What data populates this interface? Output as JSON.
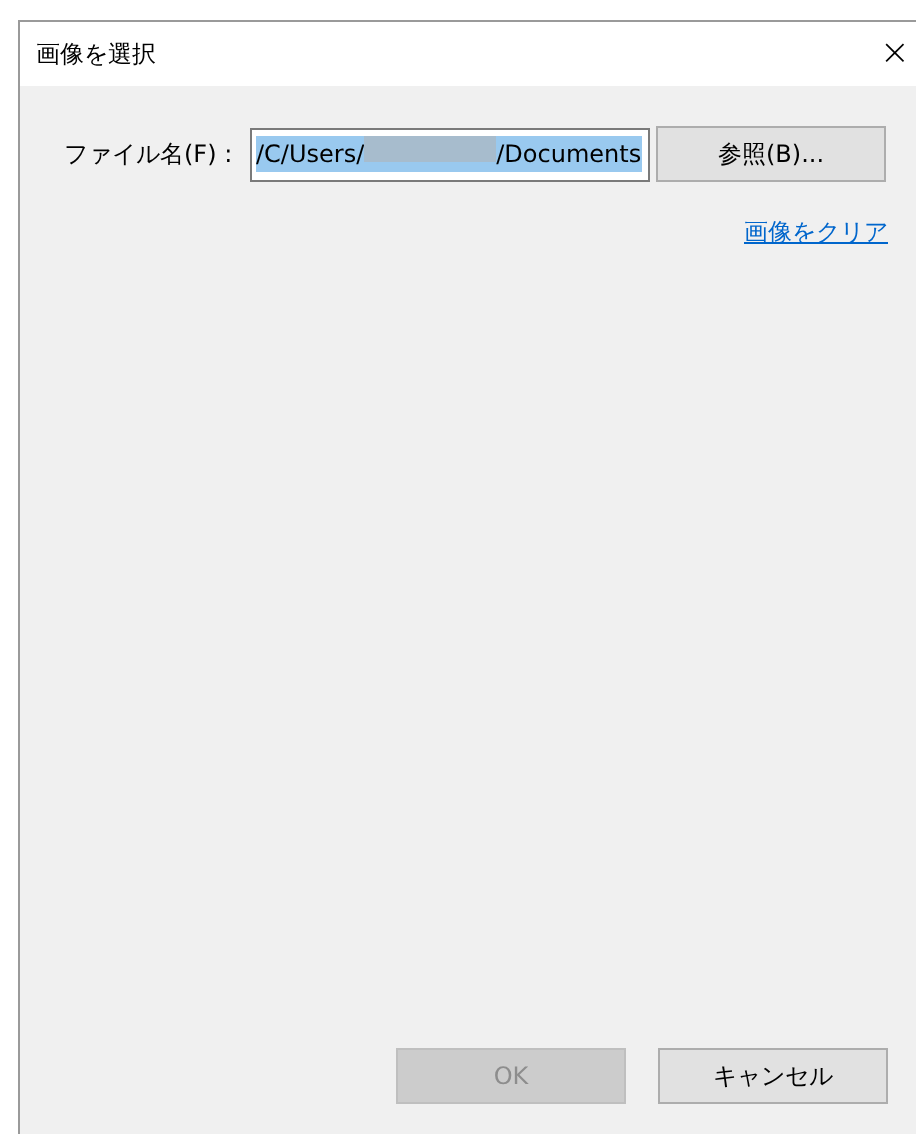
{
  "window": {
    "title": "画像を選択",
    "close": "×"
  },
  "file": {
    "label": "ファイル名(F) :",
    "value_before": "/C/Users/",
    "value_after": "/Documents",
    "redacted": true,
    "selected": true
  },
  "browse_button": {
    "label": "参照(B)..."
  },
  "clear_link": {
    "label": "画像をクリア"
  },
  "buttons": [
    {
      "label": "OK",
      "disabled": true
    },
    {
      "label": "キャンセル",
      "disabled": false
    }
  ]
}
